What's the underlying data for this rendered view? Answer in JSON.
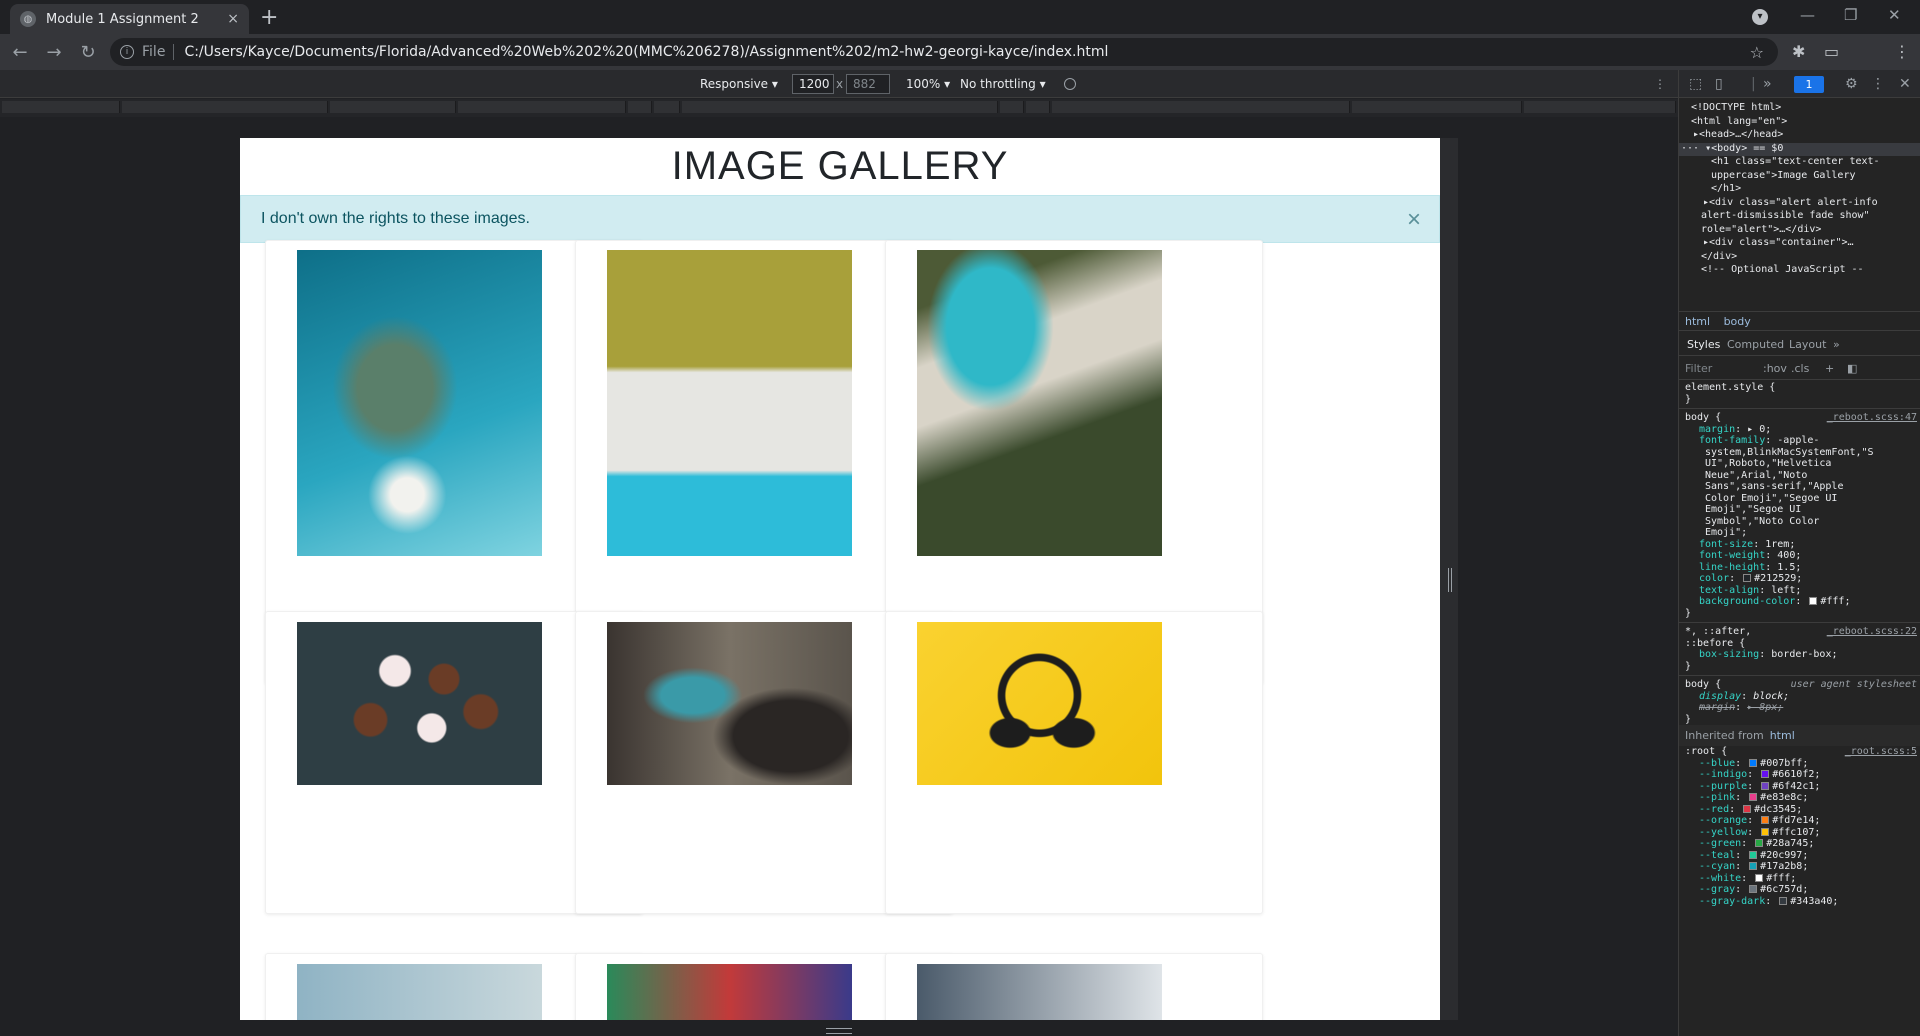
{
  "browser": {
    "tab_title": "Module 1 Assignment 2",
    "url_scheme": "File",
    "url": "C:/Users/Kayce/Documents/Florida/Advanced%20Web%202%20(MMC%206278)/Assignment%202/m2-hw2-georgi-kayce/index.html"
  },
  "device_toolbar": {
    "mode": "Responsive ▾",
    "width": "1200",
    "height": "882",
    "zoom": "100% ▾",
    "throttling": "No throttling ▾"
  },
  "page": {
    "heading": "Image Gallery",
    "alert_text": "I don't own the rights to these images.",
    "alert_close": "×",
    "images": [
      {
        "label": "aerial-ocean-reef",
        "colors": [
          "#0e6f88",
          "#2aa6c0",
          "#5a7f6a"
        ]
      },
      {
        "label": "palm-beach-top-view",
        "colors": [
          "#a8a03a",
          "#e6e6e2",
          "#2dbcd9"
        ]
      },
      {
        "label": "beach-boats-palms",
        "colors": [
          "#2fb8c8",
          "#d9d4c8",
          "#3a4a2c"
        ]
      },
      {
        "label": "cupcakes",
        "colors": [
          "#2e3e44",
          "#f4e8e8",
          "#6a3c26"
        ]
      },
      {
        "label": "graffiti-woman-headphones",
        "colors": [
          "#7a7266",
          "#3a9aa8",
          "#2a2624"
        ]
      },
      {
        "label": "headphones-yellow",
        "colors": [
          "#f2c40c",
          "#fad230",
          "#1d1d1d"
        ]
      }
    ]
  },
  "devtools": {
    "badge": "1",
    "dom_lines": [
      {
        "html": "<!DOCTYPE html>",
        "indent": 12
      },
      {
        "html": "<html lang=\"en\">",
        "indent": 12
      },
      {
        "html": "▸<head>…</head>",
        "indent": 14
      },
      {
        "html": "··· ▾<body> == $0",
        "indent": 2,
        "selected": true
      },
      {
        "html": "<h1 class=\"text-center text-",
        "indent": 32
      },
      {
        "html": "uppercase\">Image Gallery",
        "indent": 32
      },
      {
        "html": "</h1>",
        "indent": 32
      },
      {
        "html": "▸<div class=\"alert alert-info",
        "indent": 24
      },
      {
        "html": "alert-dismissible fade show\"",
        "indent": 22
      },
      {
        "html": "role=\"alert\">…</div>",
        "indent": 22
      },
      {
        "html": "▸<div class=\"container\">…",
        "indent": 24
      },
      {
        "html": "</div>",
        "indent": 22
      },
      {
        "html": "<!-- Optional JavaScript --",
        "indent": 22
      }
    ],
    "breadcrumbs": [
      "html",
      "body"
    ],
    "subtabs": [
      "Styles",
      "Computed",
      "Layout",
      "»"
    ],
    "filter_placeholder": "Filter",
    "filter_buttons": [
      ":hov",
      ".cls",
      "+"
    ],
    "style_lines": [
      {
        "t": "element.style {",
        "k": "sel"
      },
      {
        "t": "}",
        "k": "plain"
      },
      {
        "t": "sep"
      },
      {
        "t": "body {",
        "k": "sel",
        "src": "_reboot.scss:47"
      },
      {
        "p": "margin",
        "v": "▸ 0;"
      },
      {
        "p": "font-family",
        "v": "-apple-"
      },
      {
        "t": "    system,BlinkMacSystemFont,\"S",
        "k": "cont"
      },
      {
        "t": "    UI\",Roboto,\"Helvetica",
        "k": "cont"
      },
      {
        "t": "    Neue\",Arial,\"Noto",
        "k": "cont"
      },
      {
        "t": "    Sans\",sans-serif,\"Apple",
        "k": "cont"
      },
      {
        "t": "    Color Emoji\",\"Segoe UI",
        "k": "cont"
      },
      {
        "t": "    Emoji\",\"Segoe UI",
        "k": "cont"
      },
      {
        "t": "    Symbol\",\"Noto Color",
        "k": "cont"
      },
      {
        "t": "    Emoji\";",
        "k": "cont"
      },
      {
        "p": "font-size",
        "v": "1rem;"
      },
      {
        "p": "font-weight",
        "v": "400;"
      },
      {
        "p": "line-height",
        "v": "1.5;"
      },
      {
        "p": "color",
        "v": "#212529;",
        "sw": "#212529"
      },
      {
        "p": "text-align",
        "v": "left;"
      },
      {
        "p": "background-color",
        "v": "#fff;",
        "sw": "#ffffff"
      },
      {
        "t": "}",
        "k": "plain"
      },
      {
        "t": "sep"
      },
      {
        "t": "*, ::after,",
        "k": "sel",
        "src": "_reboot.scss:22"
      },
      {
        "t": "::before {",
        "k": "sel"
      },
      {
        "p": "box-sizing",
        "v": "border-box;"
      },
      {
        "t": "}",
        "k": "plain"
      },
      {
        "t": "sep"
      },
      {
        "t": "body {",
        "k": "sel",
        "ua": "user agent stylesheet"
      },
      {
        "p": "display",
        "v": "block;",
        "it": true
      },
      {
        "p": "margin",
        "v": "▸ 8px;",
        "it": true,
        "strike": true
      },
      {
        "t": "}",
        "k": "plain"
      },
      {
        "t": "inh"
      },
      {
        "t": ":root {",
        "k": "sel",
        "src": "_root.scss:5"
      },
      {
        "p": "--blue",
        "v": "#007bff;",
        "sw": "#007bff"
      },
      {
        "p": "--indigo",
        "v": "#6610f2;",
        "sw": "#6610f2"
      },
      {
        "p": "--purple",
        "v": "#6f42c1;",
        "sw": "#6f42c1"
      },
      {
        "p": "--pink",
        "v": "#e83e8c;",
        "sw": "#e83e8c"
      },
      {
        "p": "--red",
        "v": "#dc3545;",
        "sw": "#dc3545"
      },
      {
        "p": "--orange",
        "v": "#fd7e14;",
        "sw": "#fd7e14"
      },
      {
        "p": "--yellow",
        "v": "#ffc107;",
        "sw": "#ffc107"
      },
      {
        "p": "--green",
        "v": "#28a745;",
        "sw": "#28a745"
      },
      {
        "p": "--teal",
        "v": "#20c997;",
        "sw": "#20c997"
      },
      {
        "p": "--cyan",
        "v": "#17a2b8;",
        "sw": "#17a2b8"
      },
      {
        "p": "--white",
        "v": "#fff;",
        "sw": "#ffffff"
      },
      {
        "p": "--gray",
        "v": "#6c757d;",
        "sw": "#6c757d"
      },
      {
        "p": "--gray-dark",
        "v": "#343a40;",
        "sw": "#343a40"
      }
    ],
    "inherited_label": "Inherited from",
    "inherited_from": "html"
  },
  "icons": {
    "tab_close": "×",
    "new_tab": "+",
    "back": "←",
    "forward": "→",
    "reload": "↻",
    "star": "☆",
    "extensions": "✱",
    "cast": "▭",
    "menu": "⋮",
    "minimize": "—",
    "restore": "❐",
    "close": "✕",
    "profile_down": "▾"
  }
}
